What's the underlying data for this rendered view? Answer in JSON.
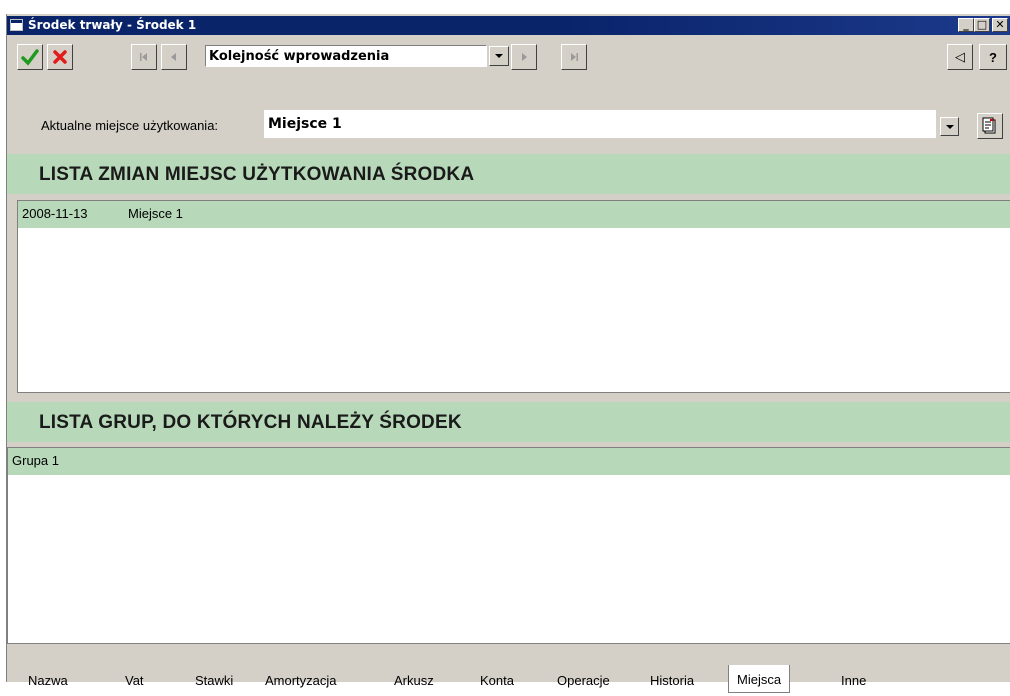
{
  "window": {
    "title": "Środek trwały - Środek 1",
    "controls": {
      "minimize": "_",
      "maximize": "□",
      "close": "✕"
    }
  },
  "toolbar": {
    "accept_icon": "check-icon",
    "cancel_icon": "x-icon",
    "first_icon": "first-icon",
    "prev_icon": "prev-icon",
    "order_combo_value": "Kolejność wprowadzenia",
    "next_icon": "next-icon",
    "last_icon": "last-icon",
    "collapse_label": "◁",
    "help_label": "?"
  },
  "location": {
    "label": "Aktualne miejsce użytkowania:",
    "value": "Miejsce 1"
  },
  "changes_section": {
    "title": "LISTA ZMIAN MIEJSC UŻYTKOWANIA ŚRODKA",
    "rows": [
      {
        "date": "2008-11-13",
        "place": "Miejsce 1"
      }
    ]
  },
  "groups_section": {
    "title": "LISTA GRUP, DO KTÓRYCH NALEŻY ŚRODEK",
    "rows": [
      {
        "name": "Grupa 1"
      }
    ]
  },
  "tabs": [
    "Nazwa",
    "Vat",
    "Stawki",
    "Amortyzacja",
    "Arkusz",
    "Konta",
    "Operacje",
    "Historia",
    "Miejsca",
    "Inne"
  ],
  "active_tab": "Miejsca",
  "colors": {
    "section_green": "#b7d9b9",
    "titlebar_blue": "#0a246a",
    "window_gray": "#d4d0c8"
  }
}
